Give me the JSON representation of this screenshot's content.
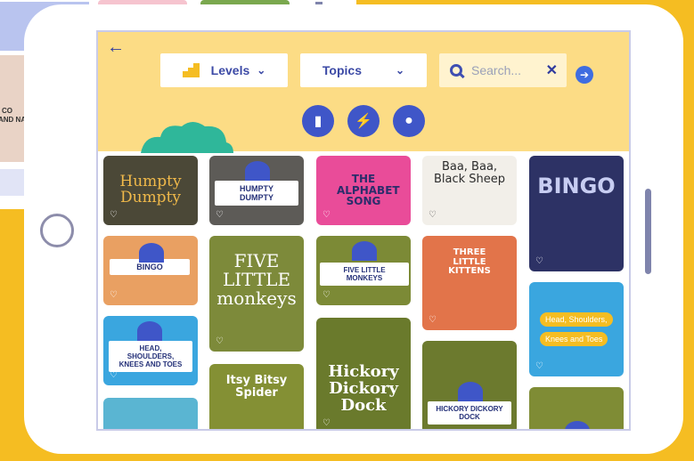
{
  "header": {
    "back_icon": "back-arrow-icon",
    "levels_label": "Levels",
    "topics_label": "Topics",
    "search_placeholder": "Search...",
    "category_buttons": [
      "book-icon",
      "lightning-icon",
      "search-icon"
    ]
  },
  "background_labels": [
    "CO",
    "AND NA"
  ],
  "tiles": {
    "humpty_art": "Humpty Dumpty",
    "humpty_badge": "HUMPTY DUMPTY",
    "alphabet": "THE ALPHABET SONG",
    "baa": "Baa, Baa, Black Sheep",
    "bingo_art": "BINGO",
    "bingo_badge": "BINGO",
    "five_monkeys_art": "FIVE LITTLE monkeys",
    "five_monkeys_badge": "FIVE LITTLE MONKEYS",
    "three_kittens": "THREE LITTLE KITTENS",
    "head_badge": "HEAD, SHOULDERS, KNEES AND TOES",
    "head_art_line1": "Head, Shoulders,",
    "head_art_line2": "Knees and Toes",
    "hickory_art": "Hickory Dickory Dock",
    "hickory_badge": "HICKORY DICKORY DOCK",
    "itsy_art": "Itsy Bitsy Spider"
  },
  "colors": {
    "background": "#f5bd22",
    "header": "#fcdc85",
    "accent": "#3f56c8"
  }
}
